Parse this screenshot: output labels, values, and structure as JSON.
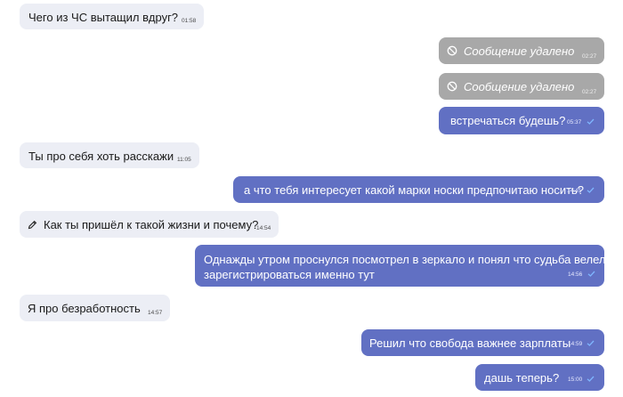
{
  "messages": [
    {
      "text": "Чего из ЧС вытащил вдруг?",
      "time": "01:58"
    },
    {
      "text": "Сообщение удалено",
      "time": "02:27"
    },
    {
      "text": "Сообщение удалено",
      "time": "02:27"
    },
    {
      "text": "встречаться будешь?",
      "time": "05:37"
    },
    {
      "text": "Ты про себя хоть расскажи",
      "time": "11:05"
    },
    {
      "text": "а что тебя интересует какой марки носки предпочитаю носить?",
      "time": "14:45"
    },
    {
      "text": "Как ты пришёл к такой жизни и почему?",
      "time": "14:54"
    },
    {
      "text_line1": "Однажды утром проснулся посмотрел в зеркало и понял что судьба велела мне",
      "text_line2": "зарегистрироваться именно тут",
      "time": "14:56"
    },
    {
      "text": "Я про безработность",
      "time": "14:57"
    },
    {
      "text": "Решил что свобода важнее зарплаты",
      "time": "14:59"
    },
    {
      "text": "дашь теперь?",
      "time": "15:00"
    }
  ],
  "colors": {
    "incoming_bg": "#eceef5",
    "outgoing_bg": "#6170c3",
    "deleted_bg": "#a8a8a8",
    "read_check": "#7fb6ff"
  },
  "icons": {
    "deleted": "deleted-icon",
    "edited": "pencil-icon",
    "read": "read-check-icon"
  }
}
